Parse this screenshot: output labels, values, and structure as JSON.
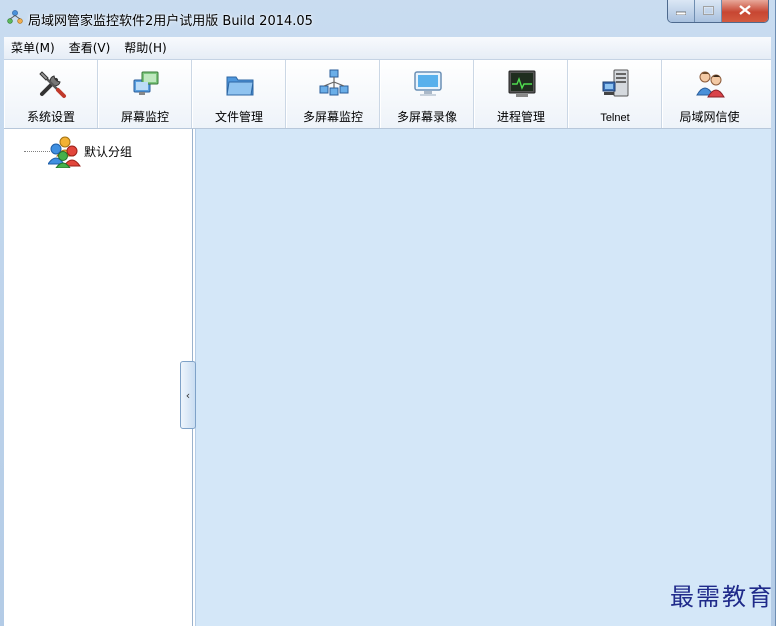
{
  "window": {
    "title": "局域网管家监控软件2用户试用版  Build 2014.05"
  },
  "menu": [
    {
      "label": "菜单(M)"
    },
    {
      "label": "查看(V)"
    },
    {
      "label": "帮助(H)"
    }
  ],
  "toolbar": [
    {
      "label": "系统设置",
      "icon": "tools-icon"
    },
    {
      "label": "屏幕监控",
      "icon": "monitor-network-icon"
    },
    {
      "label": "文件管理",
      "icon": "folder-icon"
    },
    {
      "label": "多屏幕监控",
      "icon": "multi-screen-icon"
    },
    {
      "label": "多屏幕录像",
      "icon": "display-icon"
    },
    {
      "label": "进程管理",
      "icon": "process-icon"
    },
    {
      "label": "Telnet",
      "icon": "server-icon"
    },
    {
      "label": "局域网信使",
      "icon": "messenger-icon"
    }
  ],
  "tree": {
    "nodes": [
      {
        "label": "默认分组",
        "icon": "group-icon"
      }
    ]
  },
  "collapse_handle": "‹",
  "watermark": "最需教育",
  "colors": {
    "content_bg": "#d4e7f8",
    "frame": "#b3cbe6",
    "close_button": "#c74632"
  }
}
